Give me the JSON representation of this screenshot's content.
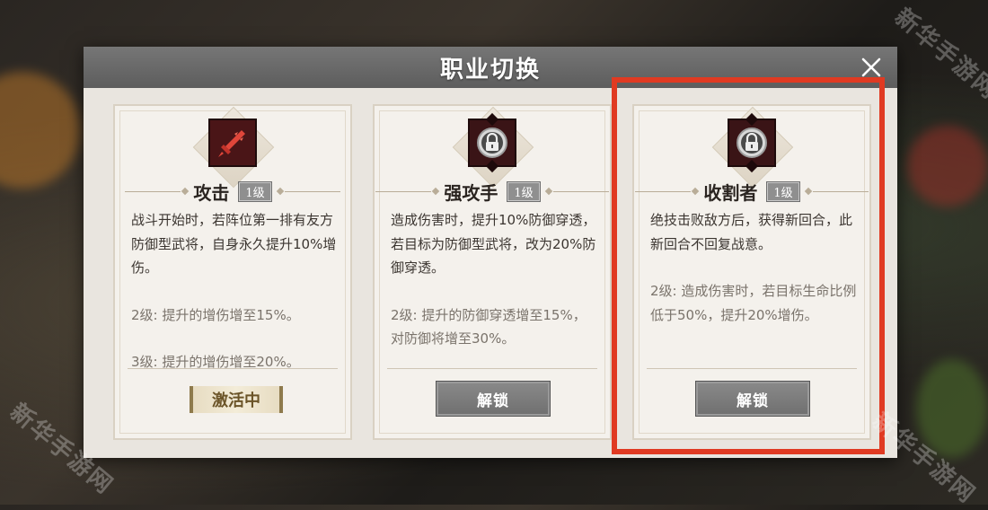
{
  "dialog": {
    "title": "职业切换",
    "close_icon": "close-icon"
  },
  "cards": [
    {
      "icon": "sword-icon",
      "name": "攻击",
      "level": "1级",
      "description": [
        "战斗开始时，若阵位第一排有友方防御型武将，自身永久提升10%增伤。"
      ],
      "upgrades": [
        "2级: 提升的增伤增至15%。",
        "3级: 提升的增伤增至20%。"
      ],
      "status": "激活中"
    },
    {
      "icon": "lock-icon",
      "name": "强攻手",
      "level": "1级",
      "description": [
        "造成伤害时，提升10%防御穿透，若目标为防御型武将，改为20%防御穿透。"
      ],
      "upgrades": [
        "2级: 提升的防御穿透增至15%，对防御将增至30%。"
      ],
      "button": "解锁"
    },
    {
      "icon": "lock-icon",
      "name": "收割者",
      "level": "1级",
      "description": [
        "绝技击败敌方后，获得新回合，此新回合不回复战意。"
      ],
      "upgrades": [
        "2级: 造成伤害时，若目标生命比例低于50%，提升20%增伤。"
      ],
      "button": "解锁"
    }
  ],
  "watermark": "新华手游网",
  "colors": {
    "highlight": "#e03a22",
    "icon_bg": "#3a1416",
    "header": "#6a6a6a"
  }
}
